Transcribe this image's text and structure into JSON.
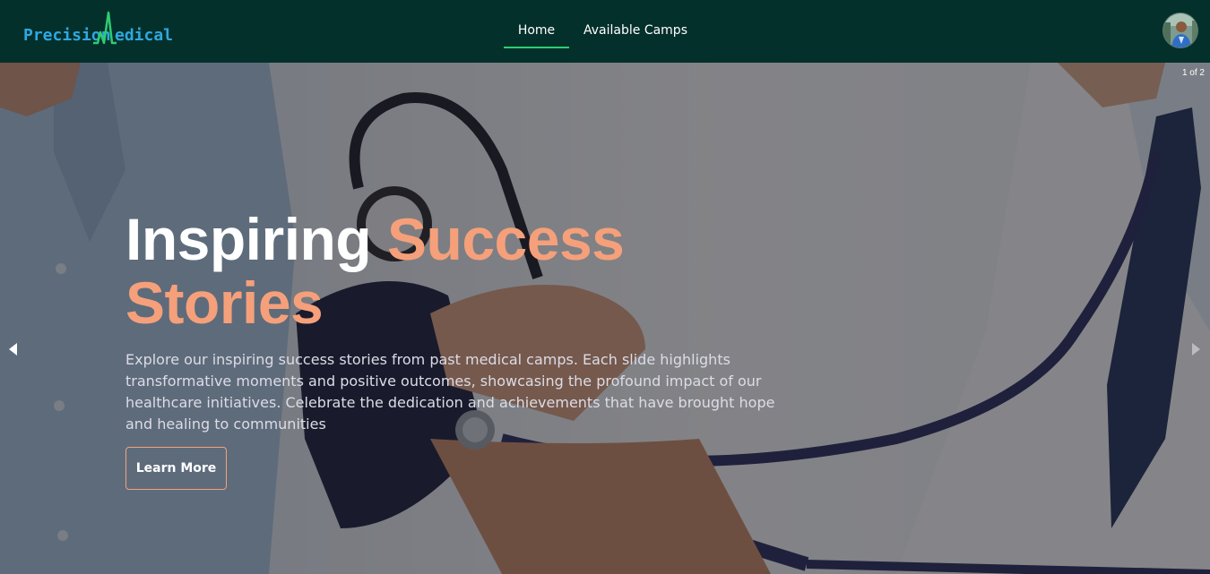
{
  "brand": {
    "part1": "Precision",
    "part2": "edical",
    "accent_color": "#2ecc71",
    "text_color": "#2ea8e0"
  },
  "nav": {
    "items": [
      {
        "label": "Home",
        "active": true
      },
      {
        "label": "Available Camps",
        "active": false
      }
    ]
  },
  "hero": {
    "slide_counter": "1 of 2",
    "title_white": "Inspiring ",
    "title_accent": "Success Stories",
    "description": "Explore our inspiring success stories from past medical camps. Each slide highlights transformative moments and positive outcomes, showcasing the profound impact of our healthcare initiatives. Celebrate the dedication and achievements that have brought hope and healing to communities",
    "cta_label": "Learn More",
    "accent_color": "#f5a07a"
  },
  "icons": {
    "prev": "chevron-left-icon",
    "next": "chevron-right-icon",
    "avatar": "user-avatar"
  },
  "colors": {
    "navbar_bg": "#04302b",
    "nav_active_underline": "#2ecc71"
  }
}
